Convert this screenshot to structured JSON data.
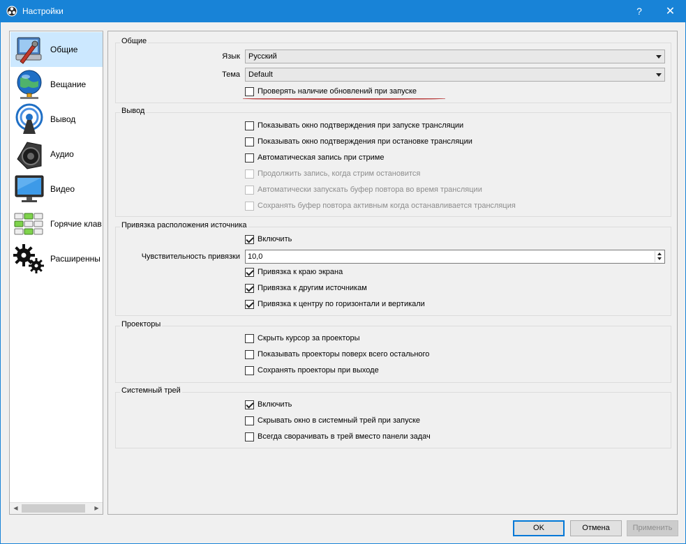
{
  "window": {
    "title": "Настройки",
    "help_label": "?",
    "close_label": "✕"
  },
  "sidebar": {
    "items": [
      {
        "label": "Общие",
        "icon": "general-wrench-icon",
        "selected": true
      },
      {
        "label": "Вещание",
        "icon": "globe-broadcast-icon"
      },
      {
        "label": "Вывод",
        "icon": "antenna-output-icon"
      },
      {
        "label": "Аудио",
        "icon": "speaker-icon"
      },
      {
        "label": "Видео",
        "icon": "monitor-icon"
      },
      {
        "label": "Горячие клав",
        "icon": "keyboard-hotkeys-icon"
      },
      {
        "label": "Расширенны",
        "icon": "gears-icon"
      }
    ]
  },
  "general": {
    "title": "Общие",
    "language_label": "Язык",
    "language_value": "Русский",
    "theme_label": "Тема",
    "theme_value": "Default",
    "check_updates": {
      "label": "Проверять наличие обновлений при запуске",
      "checked": false
    }
  },
  "output": {
    "title": "Вывод",
    "items": [
      {
        "label": "Показывать окно подтверждения при запуске трансляции",
        "checked": false,
        "enabled": true
      },
      {
        "label": "Показывать окно подтверждения при остановке трансляции",
        "checked": false,
        "enabled": true
      },
      {
        "label": "Автоматическая запись при стриме",
        "checked": false,
        "enabled": true
      },
      {
        "label": "Продолжить запись, когда стрим остановится",
        "checked": false,
        "enabled": false
      },
      {
        "label": "Автоматически запускать буфер повтора во время трансляции",
        "checked": false,
        "enabled": false
      },
      {
        "label": "Сохранять буфер повтора активным когда останавливается трансляция",
        "checked": false,
        "enabled": false
      }
    ]
  },
  "snapping": {
    "title": "Привязка расположения источника",
    "enable": {
      "label": "Включить",
      "checked": true
    },
    "sensitivity_label": "Чувствительность привязки",
    "sensitivity_value": "10,0",
    "items": [
      {
        "label": "Привязка к краю экрана",
        "checked": true
      },
      {
        "label": "Привязка к другим источникам",
        "checked": true
      },
      {
        "label": "Привязка к центру по горизонтали и вертикали",
        "checked": true
      }
    ]
  },
  "projectors": {
    "title": "Проекторы",
    "items": [
      {
        "label": "Скрыть курсор за проекторы",
        "checked": false
      },
      {
        "label": "Показывать проекторы поверх всего остального",
        "checked": false
      },
      {
        "label": "Сохранять проекторы при выходе",
        "checked": false
      }
    ]
  },
  "tray": {
    "title": "Системный трей",
    "items": [
      {
        "label": "Включить",
        "checked": true
      },
      {
        "label": "Скрывать окно в системный трей при запуске",
        "checked": false
      },
      {
        "label": "Всегда сворачивать в трей вместо панели задач",
        "checked": false
      }
    ]
  },
  "buttons": {
    "ok": "OK",
    "cancel": "Отмена",
    "apply": "Применить"
  },
  "colors": {
    "titlebar": "#1883d7",
    "selection": "#cce8ff",
    "annotation": "#b73b3b"
  }
}
